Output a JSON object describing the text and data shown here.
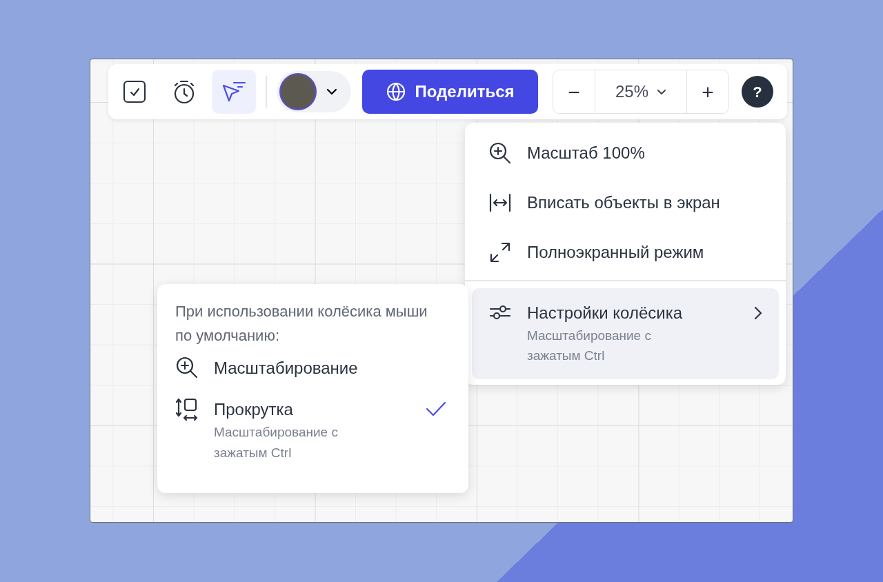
{
  "toolbar": {
    "tools": [
      {
        "kind": "tasks",
        "selected": false
      },
      {
        "kind": "timer",
        "selected": false
      },
      {
        "kind": "pointer",
        "selected": true
      }
    ],
    "avatar": {
      "kind": "photo"
    },
    "share_button": {
      "label": "Поделиться"
    },
    "zoom": {
      "minus": "−",
      "value": "25%",
      "plus": "+"
    },
    "help": {
      "label": "?"
    }
  },
  "zoom_menu": {
    "items": [
      {
        "kind": "zoom",
        "label": "Масштаб 100%",
        "selected": false
      },
      {
        "kind": "fit",
        "label": "Вписать объекты в экран",
        "selected": false
      },
      {
        "kind": "fullscreen",
        "label": "Полноэкранный режим",
        "selected": false
      },
      {
        "kind": "submenu",
        "label": "Настройки колёсика",
        "subtitle": "Масштабирование с зажатым Ctrl",
        "selected": true
      }
    ]
  },
  "wheel_menu": {
    "heading": "При использовании колёсика мыши по умолчанию:",
    "options": [
      {
        "kind": "zoom",
        "label": "Масштабирование",
        "selected": false
      },
      {
        "kind": "scroll",
        "label": "Прокрутка",
        "subtitle": "Масштабирование с зажатым Ctrl",
        "selected": true
      }
    ]
  }
}
